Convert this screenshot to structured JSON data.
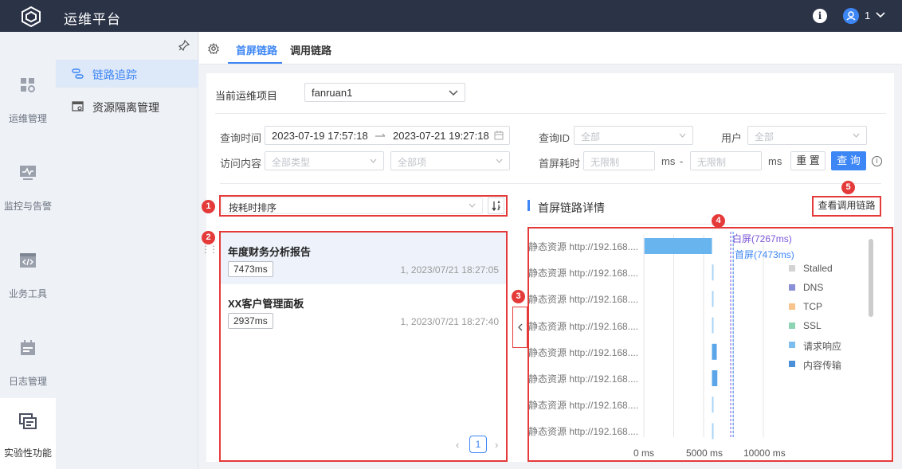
{
  "app": {
    "title": "运维平台",
    "user_name": "1"
  },
  "rail": [
    {
      "label": "运维管理",
      "icon": "dashboard-icon"
    },
    {
      "label": "监控与告警",
      "icon": "monitor-icon"
    },
    {
      "label": "业务工具",
      "icon": "code-icon"
    },
    {
      "label": "日志管理",
      "icon": "calendar-icon"
    },
    {
      "label": "实验性功能",
      "icon": "windows-icon"
    }
  ],
  "submenu": [
    {
      "label": "链路追踪",
      "icon": "trace-icon"
    },
    {
      "label": "资源隔离管理",
      "icon": "resource-icon"
    }
  ],
  "tabs": [
    "首屏链路",
    "调用链路"
  ],
  "filters": {
    "project_label": "当前运维项目",
    "project_value": "fanruan1",
    "time_label": "查询时间",
    "time_start": "2023-07-19 17:57:18",
    "time_end": "2023-07-21 19:27:18",
    "qid_label": "查询ID",
    "qid_placeholder": "全部",
    "user_label": "用户",
    "user_placeholder": "全部",
    "content_label": "访问内容",
    "content_type_placeholder": "全部类型",
    "content_item_placeholder": "全部项",
    "fs_label": "首屏耗时",
    "fs_min_placeholder": "无限制",
    "fs_max_placeholder": "无限制",
    "unit": "ms",
    "dash": "-",
    "reset": "重 置",
    "query": "查 询"
  },
  "sort": {
    "label": "按耗时排序"
  },
  "badges": [
    "1",
    "2",
    "3",
    "4",
    "5"
  ],
  "list": [
    {
      "title": "年度财务分析报告",
      "duration": "7473ms",
      "meta": "1, 2023/07/21 18:27:05"
    },
    {
      "title": "XX客户管理面板",
      "duration": "2937ms",
      "meta": "1, 2023/07/21 18:27:40"
    }
  ],
  "pager": {
    "page": "1",
    "prev": "‹",
    "next": "›"
  },
  "detail": {
    "title": "首屏链路详情",
    "view_call_chain": "查看调用链路",
    "row_label": "静态资源 http://192.168....",
    "marker_white": "白屏(7267ms)",
    "marker_first": "首屏(7473ms)",
    "x_ticks": [
      "0 ms",
      "5000 ms",
      "10000 ms"
    ]
  },
  "legend": [
    {
      "label": "Stalled",
      "color": "#d3d3d3"
    },
    {
      "label": "DNS",
      "color": "#8b8fd6"
    },
    {
      "label": "TCP",
      "color": "#f6c48c"
    },
    {
      "label": "SSL",
      "color": "#8dd4b5"
    },
    {
      "label": "请求响应",
      "color": "#7dbef0"
    },
    {
      "label": "内容传输",
      "color": "#4a8fd8"
    }
  ],
  "chart_data": {
    "type": "bar",
    "categories": [
      "静态资源 http://192.168....",
      "静态资源 http://192.168....",
      "静态资源 http://192.168....",
      "静态资源 http://192.168....",
      "静态资源 http://192.168....",
      "静态资源 http://192.168....",
      "静态资源 http://192.168....",
      "静态资源 http://192.168...."
    ],
    "xlim": [
      0,
      12000
    ],
    "x_ticks": [
      0,
      5000,
      10000
    ],
    "bars": [
      {
        "start": 50,
        "end": 5700
      },
      {
        "start": 5700,
        "end": 5780
      },
      {
        "start": 5700,
        "end": 5750
      },
      {
        "start": 5700,
        "end": 5740
      },
      {
        "start": 5700,
        "end": 6100
      },
      {
        "start": 5700,
        "end": 6150
      },
      {
        "start": 5700,
        "end": 5780
      },
      {
        "start": 5700,
        "end": 5800
      }
    ],
    "markers": [
      {
        "label": "白屏(7267ms)",
        "value": 7267,
        "color": "#7b56d8"
      },
      {
        "label": "首屏(7473ms)",
        "value": 7473,
        "color": "#3d86f5"
      }
    ]
  }
}
